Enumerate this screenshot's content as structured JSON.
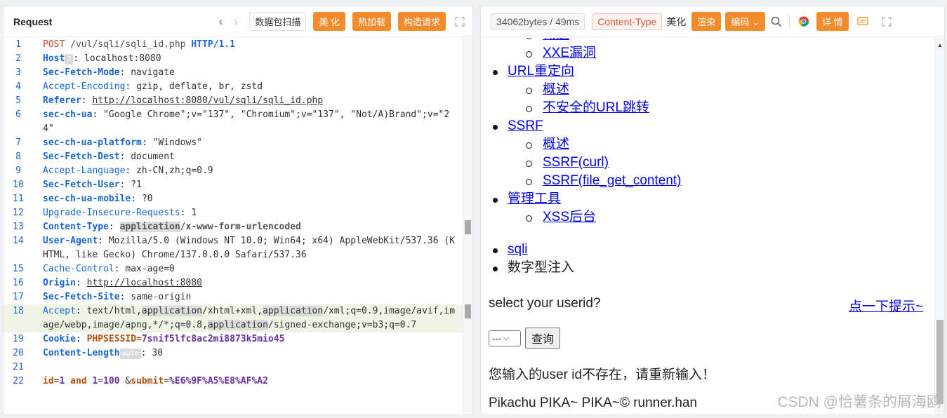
{
  "request": {
    "title": "Request",
    "btn_scan": "数据包扫描",
    "btn_beautify": "美 化",
    "btn_hotload": "热加载",
    "btn_build": "构造请求",
    "lines": {
      "n1": "1",
      "n2": "2",
      "n3": "3",
      "n4": "4",
      "n5": "5",
      "n6": "6",
      "n7": "7",
      "n8": "8",
      "n9": "9",
      "n10": "10",
      "n11": "11",
      "n12": "12",
      "n13": "13",
      "n14": "14",
      "n15": "15",
      "n16": "16",
      "n17": "17",
      "n18": "18",
      "n19": "19",
      "n20": "20",
      "n21": "21",
      "n22": "22",
      "method": "POST",
      "path": "/vul/sqli/sqli_id.php",
      "proto": "HTTP/1.1",
      "host_key": "Host",
      "host_badge": "?",
      "host_val": "localhost:8080",
      "sfm_key": "Sec-Fetch-Mode",
      "sfm_val": "navigate",
      "ae_key": "Accept-Encoding",
      "ae_val": "gzip, deflate, br, zstd",
      "ref_key": "Referer",
      "ref_val": "http://localhost:8080/vul/sqli/sqli_id.php",
      "ua_ch_key": "sec-ch-ua",
      "ua_ch_val": "\"Google Chrome\";v=\"137\", \"Chromium\";v=\"137\", \"Not/A)Brand\";v=\"24\"",
      "plat_key": "sec-ch-ua-platform",
      "plat_val": "\"Windows\"",
      "sfd_key": "Sec-Fetch-Dest",
      "sfd_val": "document",
      "al_key": "Accept-Language",
      "al_val": "zh-CN,zh;q=0.9",
      "sfu_key": "Sec-Fetch-User",
      "sfu_val": "?1",
      "mob_key": "sec-ch-ua-mobile",
      "mob_val": "?0",
      "uir_key": "Upgrade-Insecure-Requests",
      "uir_val": "1",
      "ct_key": "Content-Type",
      "ct_hl": "application",
      "ct_rest": "/x-www-form-urlencoded",
      "ua_key": "User-Agent",
      "ua_val": "Mozilla/5.0 (Windows NT 10.0; Win64; x64) AppleWebKit/537.36 (KHTML, like Gecko) Chrome/137.0.0.0 Safari/537.36",
      "cc_key": "Cache-Control",
      "cc_val": "max-age=0",
      "origin_key": "Origin",
      "origin_val": "http://localhost:8080",
      "sfs_key": "Sec-Fetch-Site",
      "sfs_val": "same-origin",
      "accept_key": "Accept",
      "acc_1": "text/html,",
      "acc_app": "application",
      "acc_2": "/xhtml+xml,",
      "acc_3": "/xml;q=0.9,image/avif,image/webp,image/apng,*/*;q=0.8,",
      "acc_4": "/signed-exchange;v=b3;q=0.7",
      "cookie_key": "Cookie",
      "cookie_name": "PHPSESSID",
      "cookie_val": "7snif5lfc8ac2mi8873k5mio45",
      "cl_key": "Content-Length",
      "cl_badge": "auto",
      "cl_val": "30",
      "b_id": "id",
      "b_id_val": "1",
      "b_and": "and",
      "b_one": "1",
      "b_hundred": "100",
      "b_amp": "&",
      "b_submit": "submit",
      "b_submit_val": "%E6%9F%A5%E8%AF%A2"
    }
  },
  "response": {
    "stats": "34062bytes / 49ms",
    "ct_btn": "Content-Type",
    "beautify": "美化",
    "render": "渲染",
    "encode": "编码",
    "detail": "详 情",
    "menu": {
      "xxe": "XXE漏洞",
      "redirect": "URL重定向",
      "overview1": "概述",
      "unsafe_redirect": "不安全的URL跳转",
      "ssrf": "SSRF",
      "overview2": "概述",
      "ssrf_curl": "SSRF(curl)",
      "ssrf_fgc": "SSRF(file_get_content)",
      "admin_tools": "管理工具",
      "xss_backend": "XSS后台",
      "sqli": "sqli",
      "numeric_inj": "数字型注入"
    },
    "question": "select your userid?",
    "hint": "点一下提示~",
    "select_val": "---",
    "query_btn": "查询",
    "message": "您输入的user id不存在，请重新输入！",
    "footer": "Pikachu PIKA~ PIKA~© runner.han",
    "watermark": "CSDN @恰薯条的屑海鸥"
  }
}
